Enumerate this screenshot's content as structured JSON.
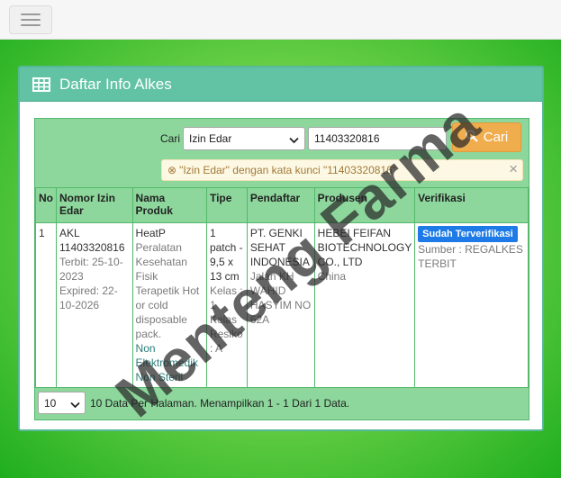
{
  "panel": {
    "title": "Daftar Info Alkes"
  },
  "search": {
    "label": "Cari",
    "field_selected": "Izin Edar",
    "keyword": "11403320816",
    "button_label": "Cari"
  },
  "alert": {
    "text": "\"Izin Edar\" dengan kata kunci \"11403320816\""
  },
  "table": {
    "headers": [
      "No",
      "Nomor Izin Edar",
      "Nama Produk",
      "Tipe",
      "Pendaftar",
      "Produsen",
      "Verifikasi"
    ],
    "rows": [
      {
        "no": "1",
        "nomor": "AKL 11403320816",
        "terbit": "Terbit: 25-10-2023",
        "expired": "Expired: 22-10-2026",
        "nama": "HeatP",
        "kategori": "Peralatan Kesehatan Fisik Terapetik Hot or cold disposable pack.",
        "jenis": "Non Elektromedik Non Steril",
        "tipe": "1 patch - 9,5 x 13 cm",
        "kelas": "Kelas : 1",
        "resiko": "Kelas Resiko : A",
        "pendaftar": "PT. GENKI SEHAT INDONESIA",
        "alamat": "Jalan KH WAHID HASYIM NO 62A",
        "produsen": "HEBEI FEIFAN BIOTECHNOLOGY CO., LTD",
        "negara": "China",
        "verifikasi": "Sudah Terverifikasi",
        "sumber": "Sumber : REGALKES TERBIT"
      }
    ]
  },
  "footer": {
    "per_page": "10",
    "info": "10 Data Per Halaman. Menampilkan 1 - 1 Dari 1 Data."
  },
  "watermark": "Menteng Farma",
  "icons": [
    "menu-icon",
    "table-icon",
    "chevron-down-icon",
    "search-icon",
    "close-icon",
    "times-circle-icon"
  ]
}
